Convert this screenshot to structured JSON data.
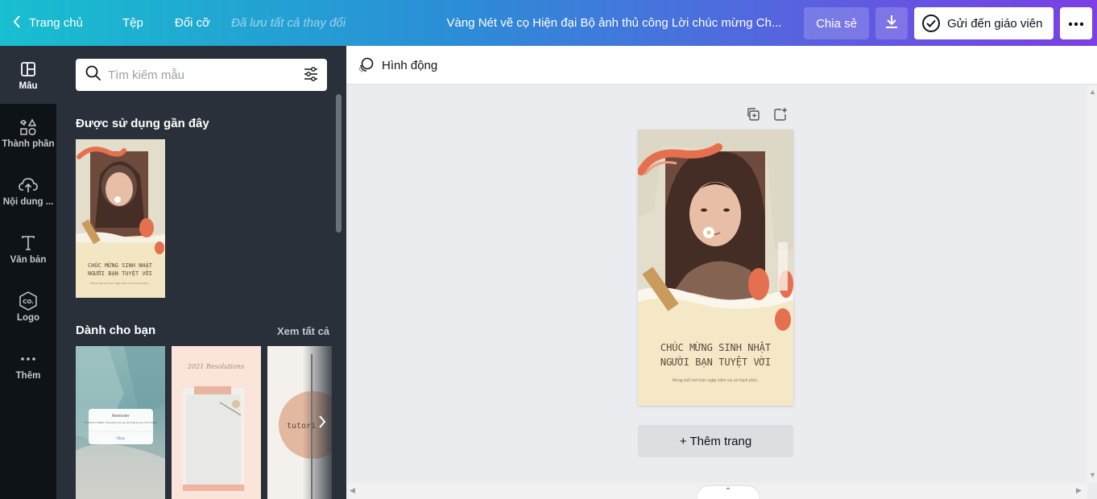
{
  "header": {
    "back_label": "Trang chủ",
    "file_label": "Tệp",
    "resize_label": "Đổi cỡ",
    "saved_status": "Đã lưu tất cả thay đổi",
    "doc_title": "Vàng Nét vẽ cọ Hiện đại Bộ ảnh thủ công Lời chúc mừng Ch...",
    "share_label": "Chia sẻ",
    "send_label": "Gửi đến giáo viên"
  },
  "sidebar": {
    "items": [
      {
        "label": "Mẫu",
        "icon": "template-icon",
        "active": true
      },
      {
        "label": "Thành phần",
        "icon": "elements-icon"
      },
      {
        "label": "Nội dung ...",
        "icon": "upload-cloud-icon"
      },
      {
        "label": "Văn bản",
        "icon": "text-icon"
      },
      {
        "label": "Logo",
        "icon": "logo-icon"
      },
      {
        "label": "Thêm",
        "icon": "more-dots-icon"
      }
    ]
  },
  "panel": {
    "search_placeholder": "Tìm kiếm mẫu",
    "recent_title": "Được sử dụng gần đây",
    "for_you_title": "Dành cho bạn",
    "see_all": "Xem tất cả",
    "thumb_fy1_title": "Reminder",
    "thumb_fy1_body": "It doesn't matter how slow you go as long as you don't stop.",
    "thumb_fy1_ok": "Okay",
    "thumb_fy2_title": "2021 Resolutions",
    "thumb_fy3_title": "tutori"
  },
  "editor": {
    "animate_label": "Hình động",
    "add_page_label": "+ Thêm trang"
  },
  "design": {
    "line1": "CHÚC MỪNG SINH NHẬT",
    "line2": "NGƯỜI BẠN TUYỆT VỜI",
    "small": "Mong tuổi mới tràn ngập niềm vui và hạnh phúc."
  },
  "colors": {
    "accent_orange": "#e4704f",
    "card_bg": "#f5e8c6",
    "panel_bg": "#293039",
    "rail_bg": "#0e1318"
  }
}
